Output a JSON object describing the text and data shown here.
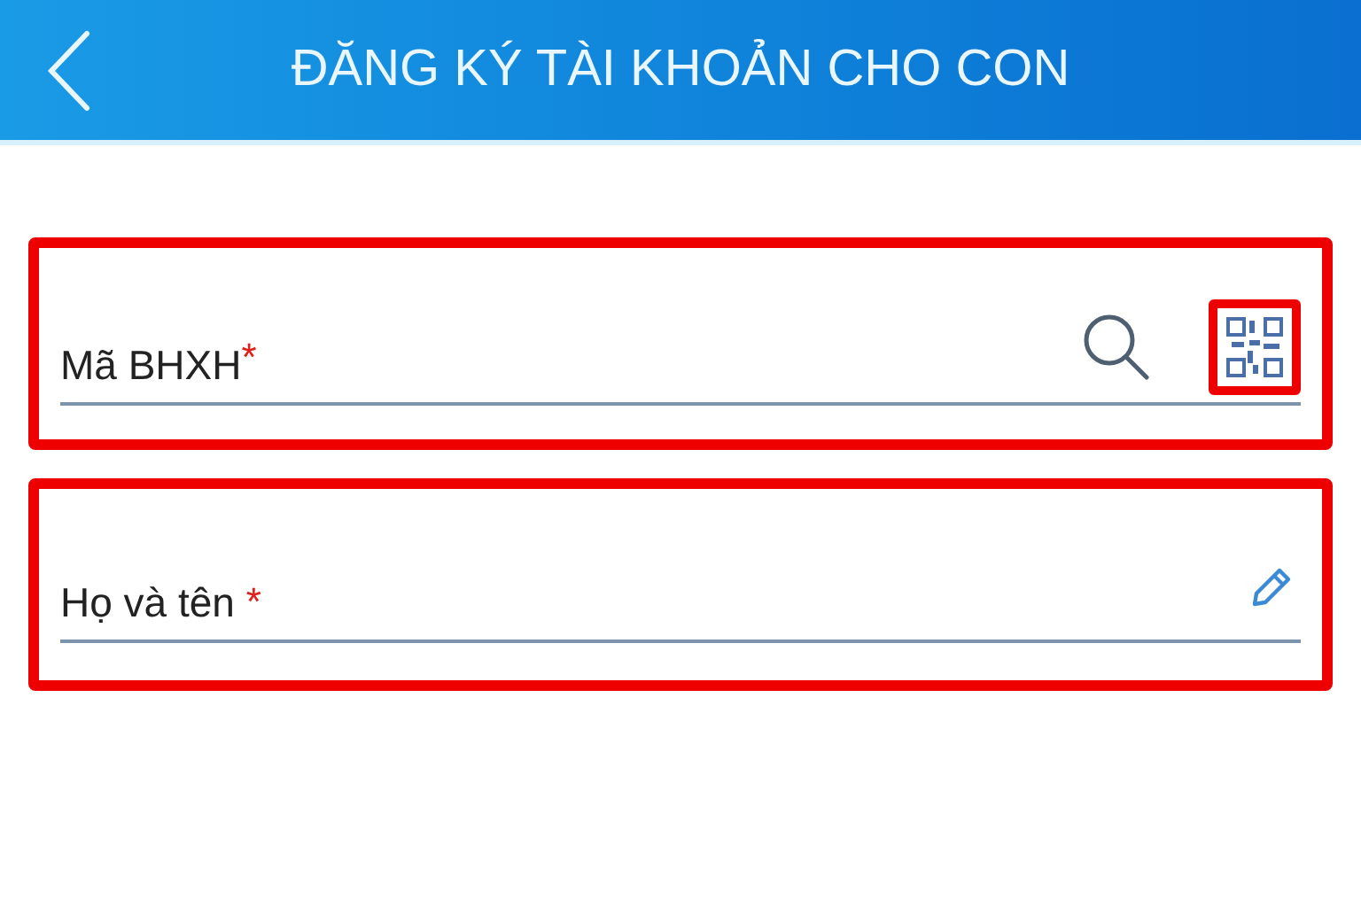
{
  "header": {
    "title": "ĐĂNG KÝ TÀI KHOẢN CHO CON"
  },
  "fields": [
    {
      "label": "Mã BHXH",
      "required_mark": "*",
      "highlighted": true,
      "icons": [
        {
          "kind": "search",
          "highlighted": false
        },
        {
          "kind": "qr",
          "highlighted": true
        }
      ]
    },
    {
      "label": "Họ và tên ",
      "required_mark": "*",
      "highlighted": true,
      "icons": [
        {
          "kind": "edit",
          "highlighted": false
        }
      ]
    }
  ]
}
